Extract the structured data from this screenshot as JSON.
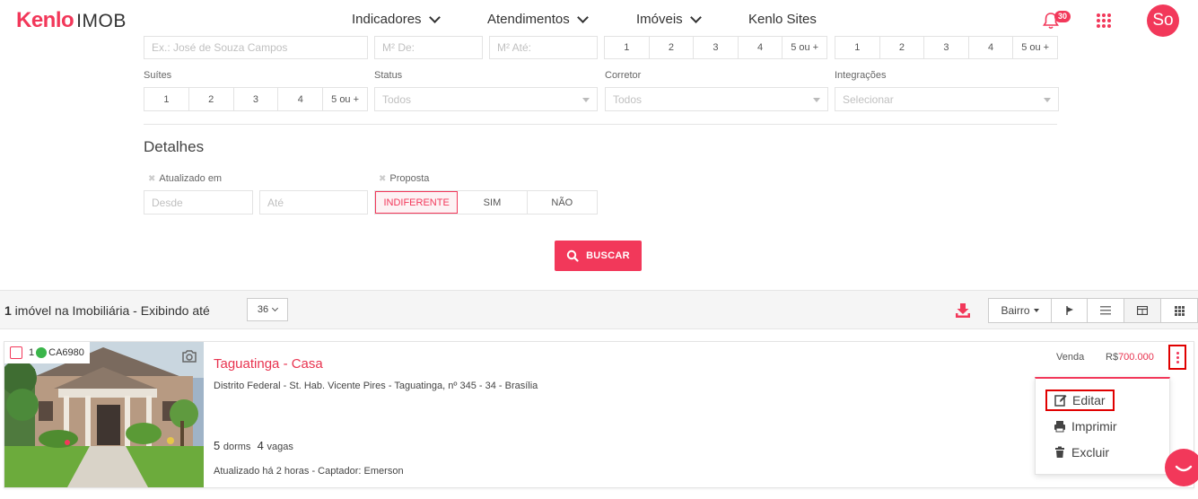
{
  "header": {
    "logo_brand": "Kenlo",
    "logo_product": "IMOB",
    "nav": [
      {
        "label": "Indicadores"
      },
      {
        "label": "Atendimentos"
      },
      {
        "label": "Imóveis"
      },
      {
        "label": "Kenlo Sites"
      }
    ],
    "notifications_count": "30",
    "avatar_initials": "So"
  },
  "filters": {
    "row1": {
      "name_placeholder": "Ex.: José de Souza Campos",
      "area_from_placeholder": "M² De:",
      "area_to_placeholder": "M² Até:",
      "dorms_options": [
        "1",
        "2",
        "3",
        "4",
        "5 ou +"
      ],
      "vagas_options": [
        "1",
        "2",
        "3",
        "4",
        "5 ou +"
      ]
    },
    "row2": {
      "suites_label": "Suítes",
      "suites_options": [
        "1",
        "2",
        "3",
        "4",
        "5 ou +"
      ],
      "status_label": "Status",
      "status_value": "Todos",
      "corretor_label": "Corretor",
      "corretor_value": "Todos",
      "integracoes_label": "Integrações",
      "integracoes_value": "Selecionar"
    },
    "detalhes": {
      "title": "Detalhes",
      "atualizado_label": "Atualizado em",
      "desde_placeholder": "Desde",
      "ate_placeholder": "Até",
      "proposta_label": "Proposta",
      "proposta_options": [
        "INDIFERENTE",
        "SIM",
        "NÃO"
      ],
      "proposta_selected": "INDIFERENTE"
    },
    "search_button": "BUSCAR"
  },
  "results": {
    "count": "1",
    "text_suffix": " imóvel na Imobiliária - Exibindo até",
    "per_page": "36",
    "sort_label": "Bairro"
  },
  "property": {
    "index": "1",
    "code": "CA6980",
    "title": "Taguatinga - Casa",
    "address": "Distrito Federal - St. Hab. Vicente Pires - Taguatinga, nº 345 - 34 - Brasília",
    "dorms": "5",
    "dorms_unit": "dorms",
    "vagas": "4",
    "vagas_unit": "vagas",
    "updated": "Atualizado há 2 horas - Captador: Emerson",
    "deal_type": "Venda",
    "currency": "R$",
    "price": "700.000"
  },
  "menu": {
    "edit": "Editar",
    "print": "Imprimir",
    "delete": "Excluir"
  },
  "colors": {
    "accent": "#f2385a",
    "highlight_outline": "#e00000",
    "status_green": "#3ab54a"
  }
}
